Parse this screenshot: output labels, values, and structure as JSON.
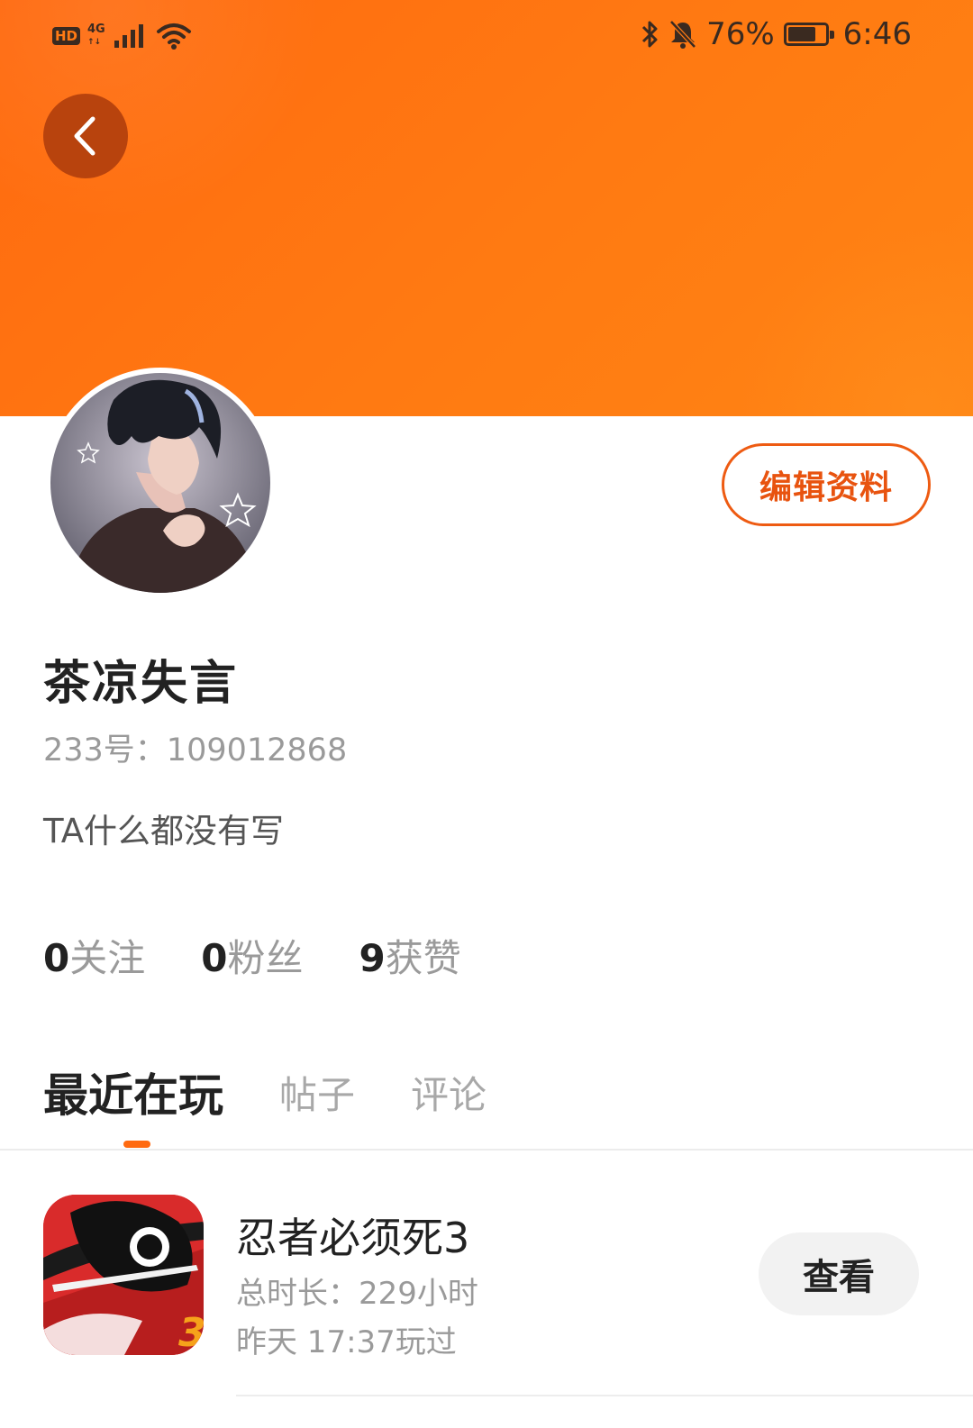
{
  "status_bar": {
    "hd": "HD",
    "network": "4G",
    "battery": "76%",
    "battery_level": 0.76,
    "time": "6:46"
  },
  "colors": {
    "accent": "#ff6a10",
    "accent_dark": "#e8530f",
    "text_primary": "#222222",
    "text_secondary": "#9a9a9a"
  },
  "header": {
    "back_icon": "chevron-left-icon"
  },
  "profile": {
    "edit_button": "编辑资料",
    "username": "茶凉失言",
    "user_id": "233号：109012868",
    "bio": "TA什么都没有写"
  },
  "stats": [
    {
      "count": "0",
      "label": "关注"
    },
    {
      "count": "0",
      "label": "粉丝"
    },
    {
      "count": "9",
      "label": "获赞"
    }
  ],
  "tabs": [
    {
      "label": "最近在玩",
      "active": true
    },
    {
      "label": "帖子",
      "active": false
    },
    {
      "label": "评论",
      "active": false
    }
  ],
  "games": [
    {
      "title": "忍者必须死3",
      "playtime": "总时长：229小时",
      "last_played": "昨天 17:37玩过",
      "action": "查看",
      "icon_badge": "3"
    }
  ]
}
